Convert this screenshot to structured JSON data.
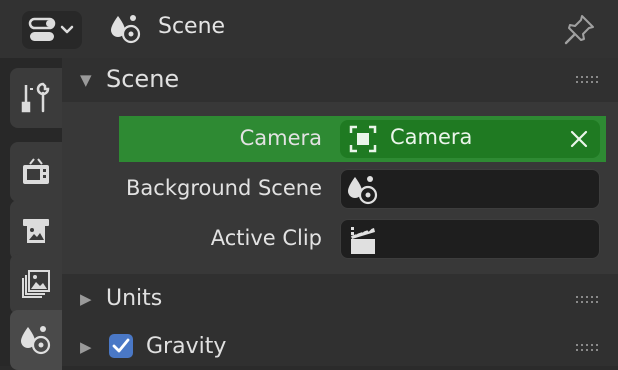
{
  "header": {
    "title": "Scene"
  },
  "sections": {
    "scene": {
      "title": "Scene",
      "expanded": true
    },
    "units": {
      "title": "Units",
      "expanded": false
    },
    "gravity": {
      "title": "Gravity",
      "expanded": false,
      "checked": true
    }
  },
  "fields": {
    "camera": {
      "label": "Camera",
      "value": "Camera"
    },
    "background_scene": {
      "label": "Background Scene",
      "value": ""
    },
    "active_clip": {
      "label": "Active Clip",
      "value": ""
    }
  },
  "sidebar": {
    "tabs": [
      {
        "name": "Tool"
      },
      {
        "name": "Render"
      },
      {
        "name": "Output"
      },
      {
        "name": "View Layer"
      },
      {
        "name": "Scene",
        "active": true
      }
    ]
  },
  "colors": {
    "accent_green": "#2e8a33",
    "checkbox_blue": "#4a78c6"
  },
  "icons": {
    "editor": "properties-editor-icon",
    "scene": "scene-icon",
    "pin": "pin-icon",
    "camera": "camera-object-icon",
    "clip": "movie-clip-icon"
  }
}
